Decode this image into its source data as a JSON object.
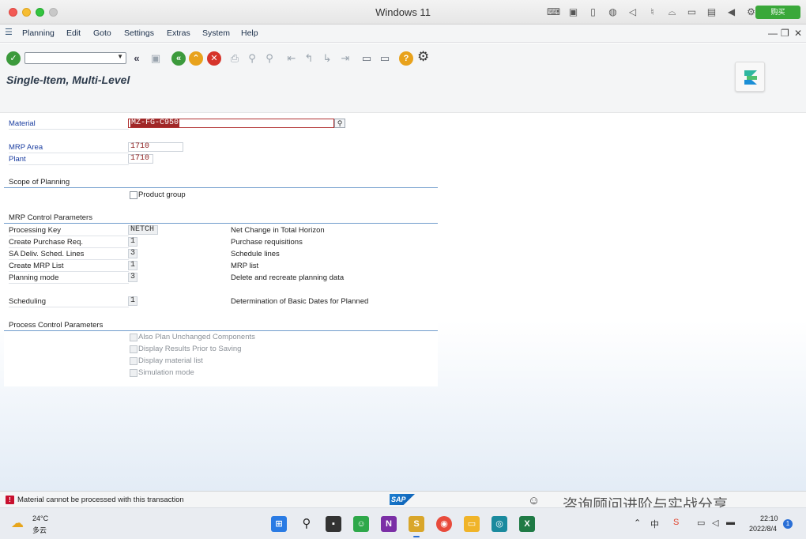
{
  "window": {
    "title": "Windows 11",
    "buy_label": "购买"
  },
  "menu": {
    "items": [
      "Planning",
      "Edit",
      "Goto",
      "Settings",
      "Extras",
      "System",
      "Help"
    ]
  },
  "page": {
    "title": "Single-Item, Multi-Level"
  },
  "selection": {
    "material_label": "Material",
    "material_value": "MZ-FG-C950",
    "mrp_area_label": "MRP Area",
    "mrp_area_value": "1710",
    "plant_label": "Plant",
    "plant_value": "1710"
  },
  "scope": {
    "title": "Scope of Planning",
    "product_group_label": "Product group",
    "product_group_checked": false
  },
  "mrp_control": {
    "title": "MRP Control Parameters",
    "rows": [
      {
        "label": "Processing Key",
        "value": "NETCH",
        "desc": "Net Change in Total Horizon"
      },
      {
        "label": "Create Purchase Req.",
        "value": "1",
        "desc": "Purchase requisitions"
      },
      {
        "label": "SA Deliv. Sched. Lines",
        "value": "3",
        "desc": "Schedule lines"
      },
      {
        "label": "Create MRP List",
        "value": "1",
        "desc": "MRP list"
      },
      {
        "label": "Planning mode",
        "value": "3",
        "desc": "Delete and recreate planning data"
      },
      {
        "label": "Scheduling",
        "value": "1",
        "desc": "Determination of Basic Dates for Planned"
      }
    ]
  },
  "process_control": {
    "title": "Process Control Parameters",
    "options": [
      "Also Plan Unchanged Components",
      "Display Results Prior to Saving",
      "Display material list",
      "Simulation mode"
    ]
  },
  "status": {
    "message": "Material cannot be processed with this transaction",
    "sap_logo": "SAP",
    "watermark": "咨询顾问进阶与实战分享"
  },
  "taskbar": {
    "temperature": "24°C",
    "condition": "多云",
    "time": "22:10",
    "date": "2022/8/4",
    "notifications": "1"
  },
  "colors": {
    "accent_blue": "#1a3da0",
    "error_red": "#c8102e",
    "ok_green": "#3c9a3c",
    "section_line": "#6f9ccc"
  }
}
